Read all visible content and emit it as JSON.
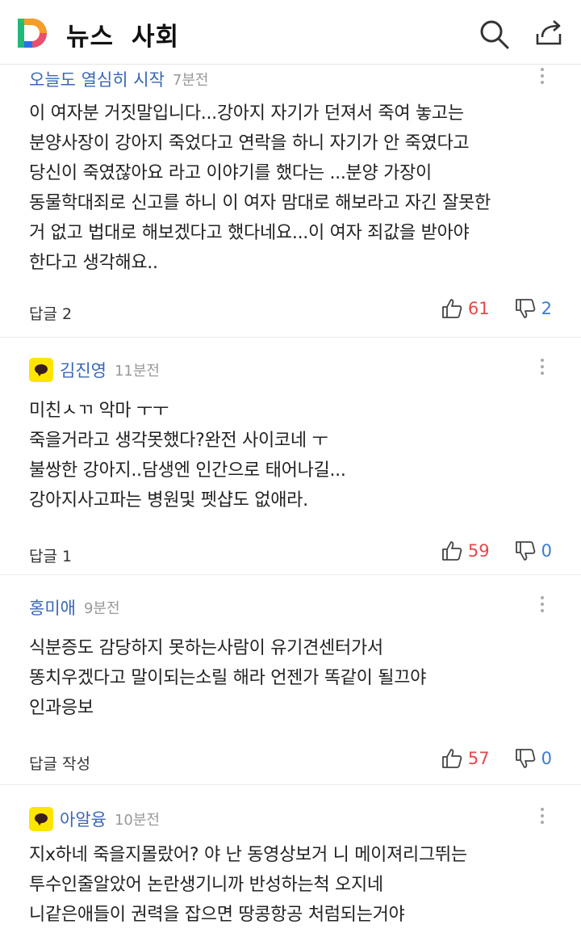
{
  "header": {
    "section": "뉴스",
    "category": "사회"
  },
  "comments": [
    {
      "author": "오늘도 열심히 시작",
      "time": "7분전",
      "has_avatar": false,
      "text": "이 여자분 거짓말입니다...강아지 자기가 던져서 죽여 놓고는\n분양사장이 강아지 죽었다고 연락을 하니 자기가 안 죽였다고\n당신이  죽였잖아요 라고 이야기를 했다는 ...분양 가장이\n동물학대죄로 신고를 하니 이 여자 맘대로 해보라고 자긴 잘못한\n거 없고 법대로 해보겠다고 했다네요...이 여자 죄값을 받아야\n한다고 생각해요..",
      "reply": "답글 2",
      "likes": "61",
      "dislikes": "2"
    },
    {
      "author": "김진영",
      "time": "11분전",
      "has_avatar": true,
      "text": "미친ㅅㄲ 악마 ㅜㅜ\n죽을거라고 생각못했다?완전 사이코네 ㅜ\n불쌍한 강아지..담생엔 인간으로 태어나길...\n강아지사고파는 병원및 펫샵도 없애라.",
      "reply": "답글 1",
      "likes": "59",
      "dislikes": "0"
    },
    {
      "author": "홍미애",
      "time": "9분전",
      "has_avatar": false,
      "text": "식분증도 감당하지 못하는사람이  유기견센터가서\n똥치우겠다고   말이되는소릴 해라 언젠가 똑같이 될끄야\n인과응보",
      "reply": "답글 작성",
      "likes": "57",
      "dislikes": "0"
    },
    {
      "author": "아알융",
      "time": "10분전",
      "has_avatar": true,
      "text": "지x하네  죽을지몰랐어?  야 난 동영상보거 니 메이져리그뛰는\n투수인줄알았어   논란생기니까 반성하는척 오지네\n니같은애들이 권력을 잡으면 땅콩항공 처럼되는거야",
      "reply": "",
      "likes": "",
      "dislikes": ""
    }
  ]
}
